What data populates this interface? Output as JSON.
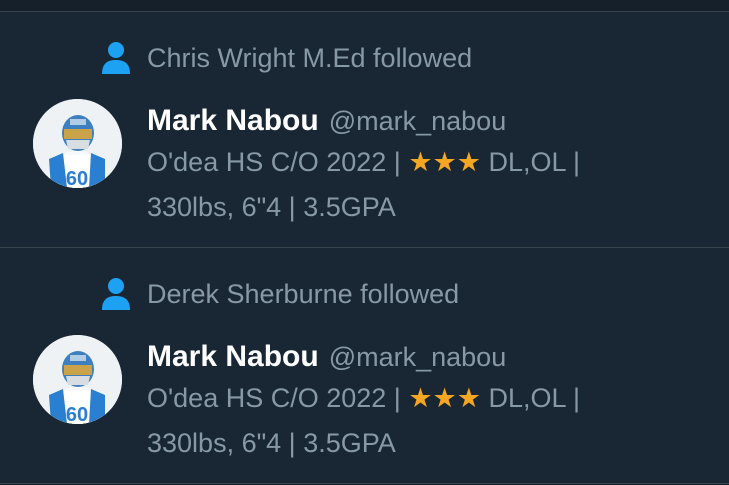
{
  "notifications": [
    {
      "follower": "Chris Wright M.Ed followed",
      "user": {
        "display_name": "Mark Nabou",
        "handle": "@mark_nabou",
        "bio_line1_prefix": "O'dea HS C/O 2022 | ",
        "bio_stars": "★★★",
        "bio_line1_suffix": " DL,OL |",
        "bio_line2": "330lbs, 6\"4 | 3.5GPA"
      }
    },
    {
      "follower": "Derek Sherburne followed",
      "user": {
        "display_name": "Mark Nabou",
        "handle": "@mark_nabou",
        "bio_line1_prefix": "O'dea HS C/O 2022 | ",
        "bio_stars": "★★★",
        "bio_line1_suffix": " DL,OL |",
        "bio_line2": "330lbs, 6\"4 | 3.5GPA"
      }
    }
  ],
  "colors": {
    "background": "#15202b",
    "card": "#192734",
    "accent": "#1da1f2",
    "muted_text": "#8899a6",
    "star": "#f5a623"
  },
  "icons": {
    "follow": "person-icon"
  }
}
